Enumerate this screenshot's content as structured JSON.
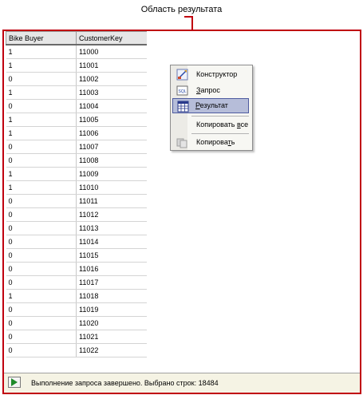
{
  "caption": "Область результата",
  "grid": {
    "columns": [
      "Bike Buyer",
      "CustomerKey"
    ],
    "rows": [
      [
        "1",
        "11000"
      ],
      [
        "1",
        "11001"
      ],
      [
        "0",
        "11002"
      ],
      [
        "1",
        "11003"
      ],
      [
        "0",
        "11004"
      ],
      [
        "1",
        "11005"
      ],
      [
        "1",
        "11006"
      ],
      [
        "0",
        "11007"
      ],
      [
        "0",
        "11008"
      ],
      [
        "1",
        "11009"
      ],
      [
        "1",
        "11010"
      ],
      [
        "0",
        "11011"
      ],
      [
        "0",
        "11012"
      ],
      [
        "0",
        "11013"
      ],
      [
        "0",
        "11014"
      ],
      [
        "0",
        "11015"
      ],
      [
        "0",
        "11016"
      ],
      [
        "0",
        "11017"
      ],
      [
        "1",
        "11018"
      ],
      [
        "0",
        "11019"
      ],
      [
        "0",
        "11020"
      ],
      [
        "0",
        "11021"
      ],
      [
        "0",
        "11022"
      ]
    ]
  },
  "status": {
    "icon": "play-icon",
    "text": "Выполнение запроса завершено. Выбрано строк: 18484"
  },
  "context_menu": {
    "items": [
      {
        "id": "designer",
        "icon": "designer-icon",
        "pre": "Конструктор",
        "acc": "",
        "post": ""
      },
      {
        "id": "query",
        "icon": "sql-query-icon",
        "pre": "",
        "acc": "З",
        "post": "апрос"
      },
      {
        "id": "result",
        "icon": "result-grid-icon",
        "pre": "",
        "acc": "Р",
        "post": "езультат",
        "selected": true
      },
      {
        "id": "copy-all",
        "icon": "",
        "pre": "Копировать ",
        "acc": "в",
        "post": "се"
      },
      {
        "id": "copy",
        "icon": "copy-icon",
        "pre": "Копирова",
        "acc": "т",
        "post": "ь"
      }
    ]
  },
  "colors": {
    "frame": "#c0000f",
    "selection": "#b6bdd9",
    "status_bg": "#f5f3e4"
  }
}
